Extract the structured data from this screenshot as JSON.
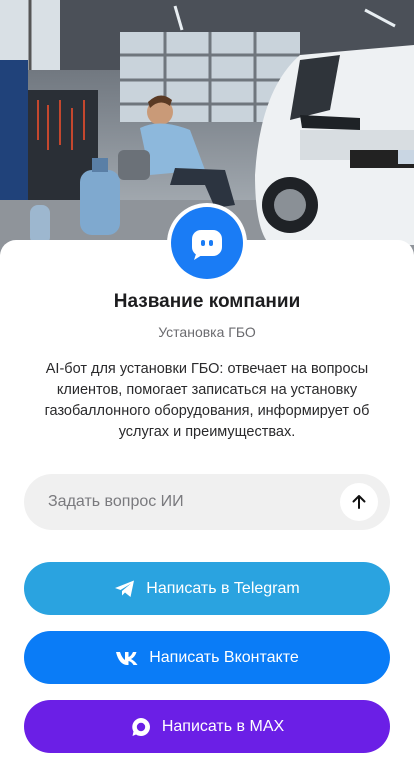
{
  "company": {
    "name": "Название компании",
    "category": "Установка ГБО",
    "description": "AI-бот для установки ГБО: отвечает на вопросы клиентов, помогает записаться на установку газобаллонного оборудования, информирует об услугах и преимуществах."
  },
  "ask": {
    "placeholder": "Задать вопрос ИИ",
    "send_icon": "arrow-up-icon"
  },
  "buttons": {
    "telegram": "Написать в Telegram",
    "vk": "Написать Вконтакте",
    "max": "Написать в MAX"
  },
  "colors": {
    "accent": "#1a7cf5",
    "telegram": "#2aa3e0",
    "vk": "#0a7cf7",
    "max": "#6b1fe6"
  },
  "icons": {
    "avatar": "chat-bot-icon",
    "telegram": "telegram-icon",
    "vk": "vk-icon",
    "max": "max-icon"
  }
}
